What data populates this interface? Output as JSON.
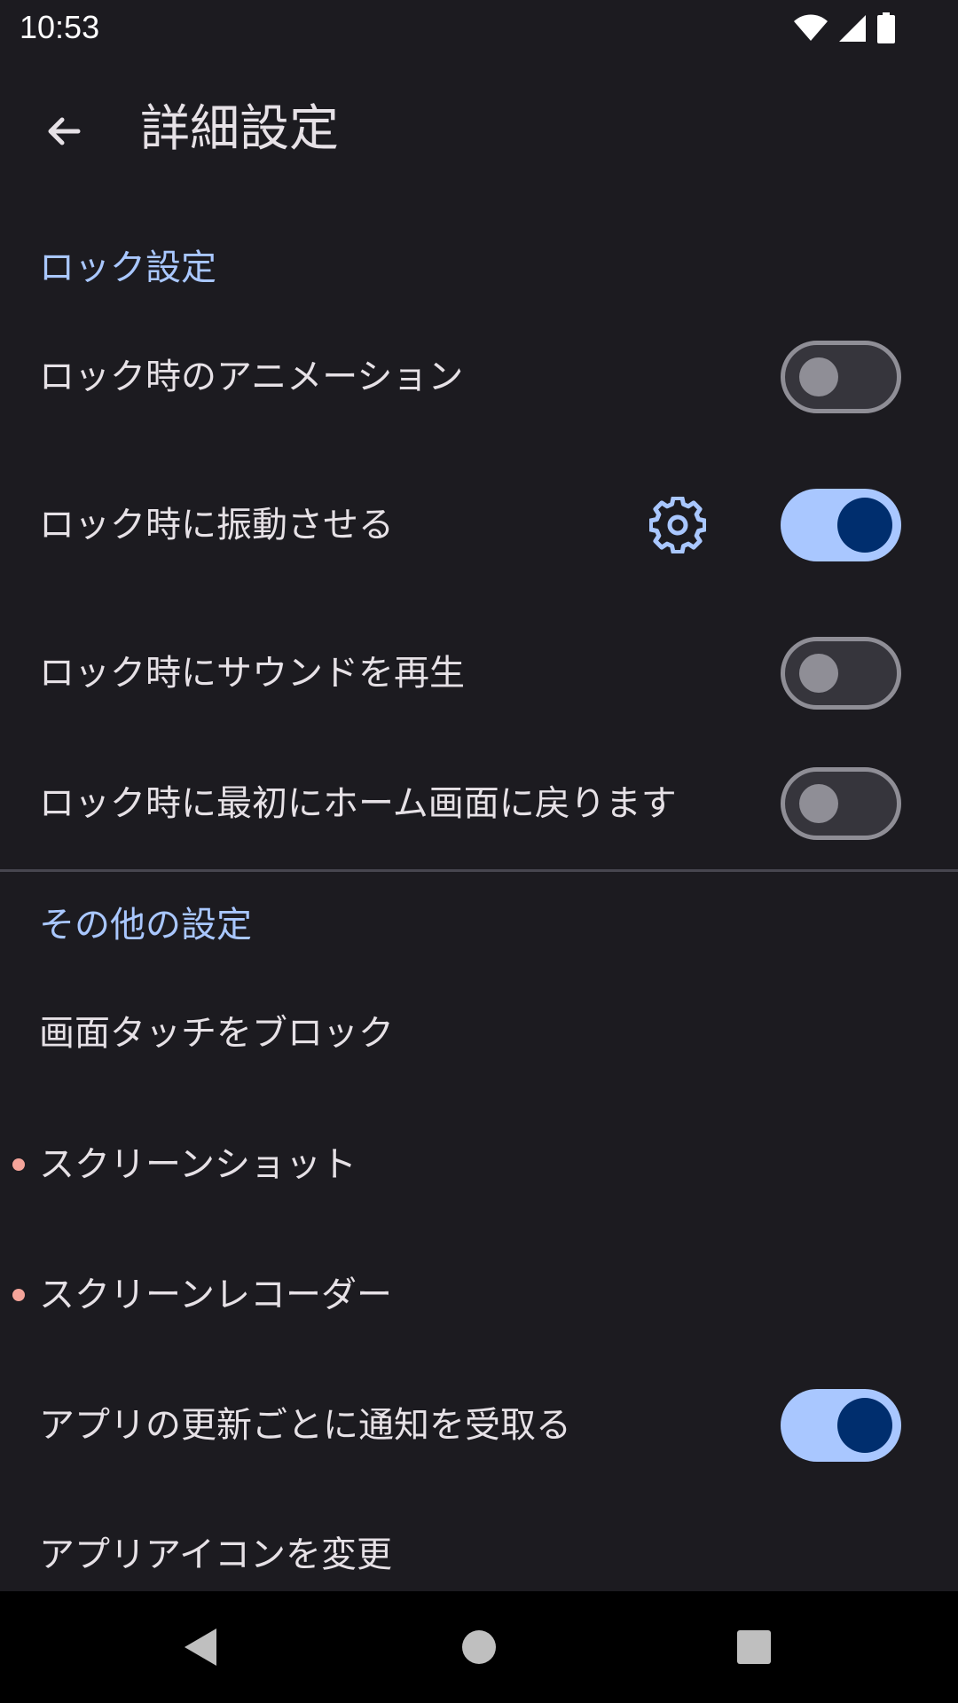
{
  "status_bar": {
    "time": "10:53",
    "icons": [
      "wifi-icon",
      "signal-icon",
      "battery-icon"
    ]
  },
  "app_bar": {
    "title": "詳細設定",
    "back_icon": "arrow-back-icon"
  },
  "sections": {
    "lock": {
      "header": "ロック設定",
      "items": [
        {
          "label": "ロック時のアニメーション",
          "toggle": "off"
        },
        {
          "label": "ロック時に振動させる",
          "toggle": "on",
          "has_settings": true
        },
        {
          "label": "ロック時にサウンドを再生",
          "toggle": "off"
        },
        {
          "label": "ロック時に最初にホーム画面に戻ります",
          "toggle": "off"
        }
      ]
    },
    "other": {
      "header": "その他の設定",
      "items": [
        {
          "label": "画面タッチをブロック"
        },
        {
          "label": "スクリーンショット",
          "new_dot": true
        },
        {
          "label": "スクリーンレコーダー",
          "new_dot": true
        },
        {
          "label": "アプリの更新ごとに通知を受取る",
          "toggle": "on"
        },
        {
          "label": "アプリアイコンを変更"
        }
      ]
    }
  },
  "colors": {
    "background": "#1c1b20",
    "accent": "#a9c7ff",
    "toggle_on_thumb": "#002e6e",
    "new_dot": "#f4a49a"
  },
  "nav_bar": {
    "icons": [
      "back-triangle-icon",
      "home-circle-icon",
      "recents-square-icon"
    ]
  }
}
